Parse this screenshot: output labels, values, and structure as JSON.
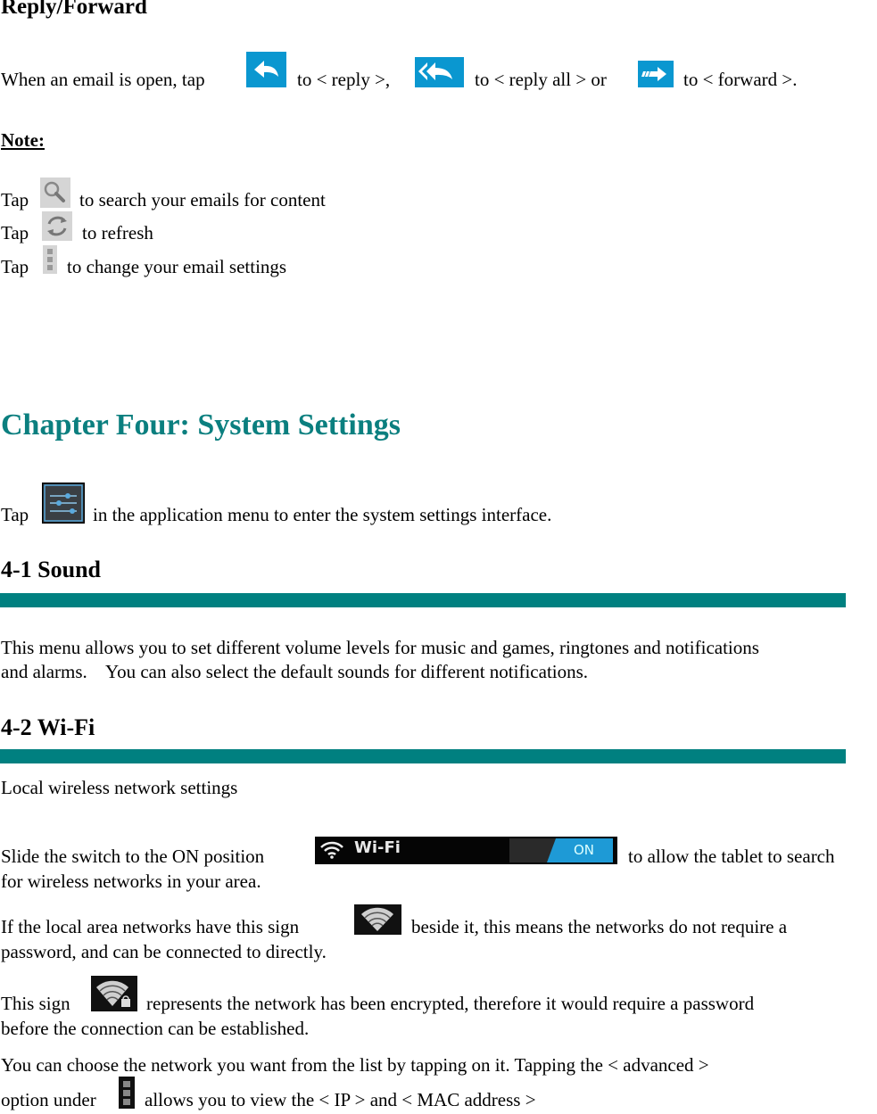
{
  "reply_forward": {
    "heading": "Reply/Forward",
    "line_parts": [
      "When an email is open, tap",
      "to < reply >,",
      "to < reply all > or",
      "to < forward >."
    ],
    "icons": [
      "reply-icon",
      "reply-all-icon",
      "forward-icon"
    ]
  },
  "note": {
    "label": "Note:",
    "items": [
      {
        "prefix": "Tap",
        "icon": "search-icon",
        "text": "to search your emails for content"
      },
      {
        "prefix": "Tap",
        "icon": "refresh-icon",
        "text": "to refresh"
      },
      {
        "prefix": "Tap",
        "icon": "overflow-menu-icon",
        "text": "to change your email settings"
      }
    ]
  },
  "chapter": {
    "title": "Chapter Four: System Settings",
    "intro_prefix": "Tap",
    "intro_icon": "settings-icon",
    "intro_text": "in the application menu to enter the system settings interface."
  },
  "sound": {
    "heading": "4-1 Sound",
    "paragraph_line1": "This menu allows you to set different volume levels for music and games, ringtones and notifications",
    "paragraph_line2": "and alarms.    You can also select the default sounds for different notifications."
  },
  "wifi": {
    "heading": "4-2 Wi-Fi",
    "subtitle": "Local wireless network settings",
    "switch_prefix": "Slide the switch to the ON position",
    "switch_label": "Wi-Fi",
    "switch_state": "ON",
    "switch_suffix": "to allow the tablet to search",
    "switch_line2": "for wireless networks in your area.",
    "open_prefix": "If the local area networks have this sign",
    "open_suffix": "beside it, this means the networks do not require a",
    "open_line2": "password, and can be connected to directly.",
    "secure_prefix": "This sign",
    "secure_suffix": "represents the network has been encrypted, therefore it would require a password",
    "secure_line2": "before the connection can be established.",
    "choose_line1": "You can choose the network you want from the list by tapping on it. Tapping the < advanced >",
    "choose_prefix": "option under",
    "choose_suffix": "allows you to view the < IP > and < MAC address >"
  },
  "colors": {
    "accent": "#008080",
    "chapter_title": "#0b7f7f",
    "icon_blue": "#0a97d0"
  }
}
